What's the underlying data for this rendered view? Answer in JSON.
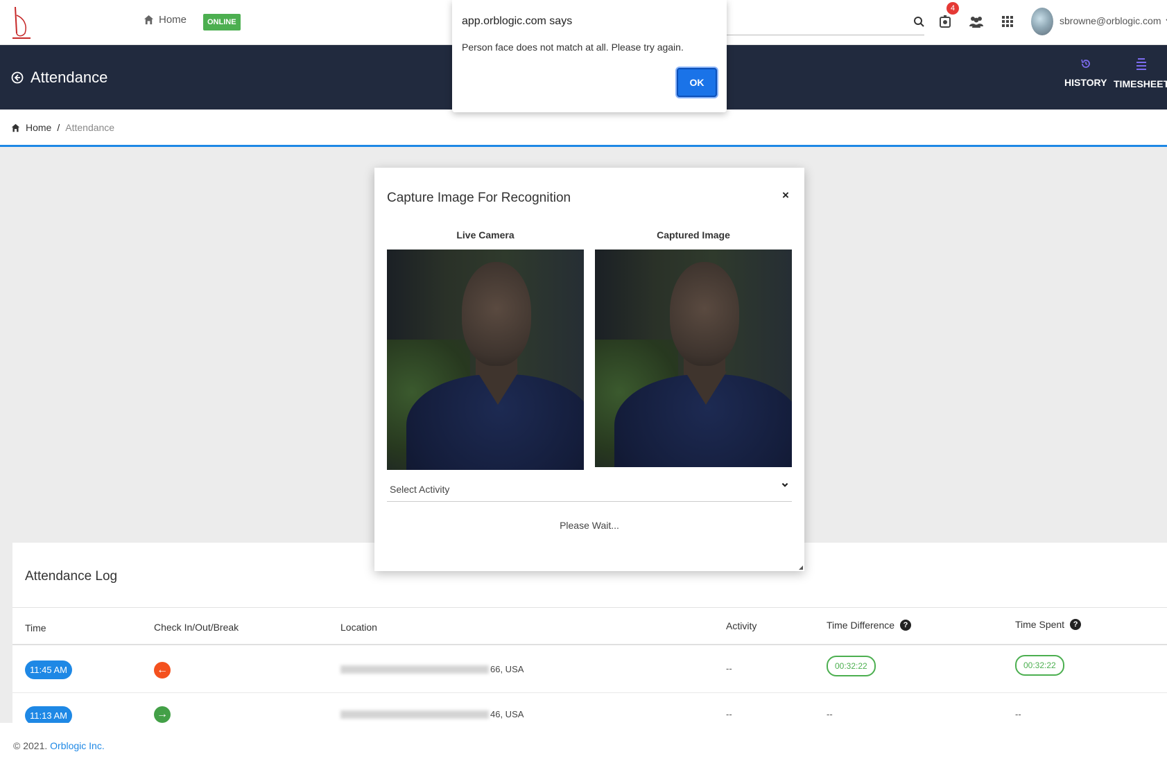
{
  "topnav": {
    "home_label": "Home",
    "status_badge": "ONLINE",
    "notification_count": "4",
    "user_email": "sbrowne@orblogic.com",
    "icons": [
      "home-icon",
      "search-icon",
      "notification-icon",
      "team-icon",
      "apps-grid-icon",
      "chevron-down-icon"
    ]
  },
  "header": {
    "title": "Attendance",
    "actions": [
      {
        "label": "HISTORY",
        "icon": "history-icon"
      },
      {
        "label": "TIMESHEET",
        "icon": "timesheet-icon"
      }
    ]
  },
  "breadcrumb": {
    "home": "Home",
    "separator": "/",
    "current": "Attendance"
  },
  "attendance_log": {
    "title": "Attendance Log",
    "columns": [
      "Time",
      "Check In/Out/Break",
      "Location",
      "Activity",
      "Time Difference",
      "Time Spent"
    ],
    "rows": [
      {
        "time": "11:45 AM",
        "direction": "out",
        "location_suffix": "66, USA",
        "activity": "--",
        "time_difference": "00:32:22",
        "time_spent": "00:32:22"
      },
      {
        "time": "11:13 AM",
        "direction": "in",
        "location_suffix": "46, USA",
        "activity": "--",
        "time_difference": "--",
        "time_spent": "--"
      }
    ]
  },
  "footer": {
    "copyright": "© 2021.",
    "company": "Orblogic Inc."
  },
  "modal": {
    "title": "Capture Image For Recognition",
    "close_label": "×",
    "live_camera_label": "Live Camera",
    "captured_image_label": "Captured Image",
    "select_placeholder": "Select Activity",
    "status_text": "Please Wait..."
  },
  "alert": {
    "title": "app.orblogic.com says",
    "message": "Person face does not match at all. Please try again.",
    "ok_label": "OK"
  },
  "colors": {
    "header_bg": "#212a3e",
    "accent": "#1e88e5",
    "online": "#4caf50",
    "check_out": "#f4511e",
    "check_in": "#43a047",
    "badge": "#e53935"
  }
}
